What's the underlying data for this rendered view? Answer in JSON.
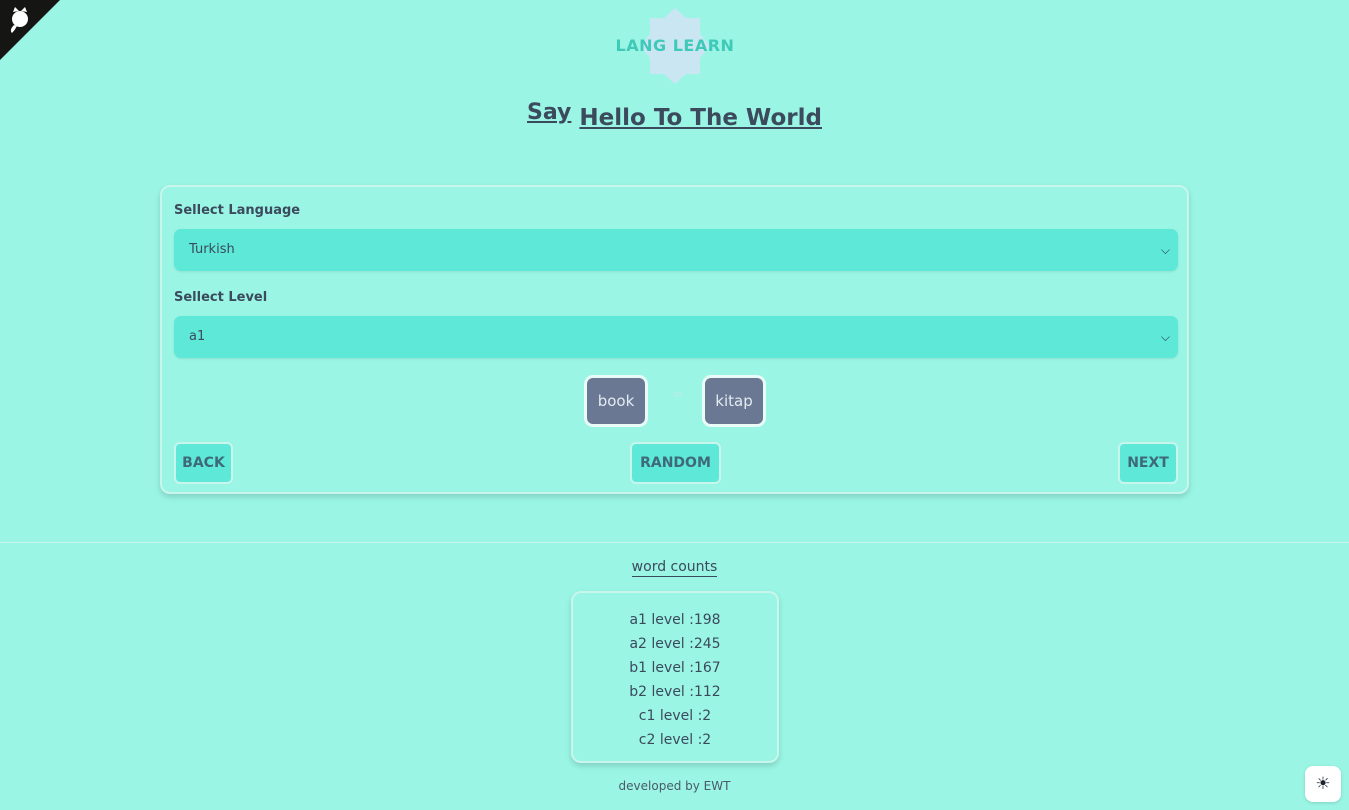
{
  "logo": {
    "text": "LANG LEARN"
  },
  "headline": {
    "say": "Say",
    "hello": "Hello To The World"
  },
  "form": {
    "language_label": "Sellect Language",
    "language_value": "Turkish",
    "level_label": "Sellect Level",
    "level_value": "a1"
  },
  "word": {
    "source": "book",
    "separator": "=",
    "target": "kitap"
  },
  "buttons": {
    "back": "BACK",
    "random": "RANDOM",
    "next": "NEXT"
  },
  "counts": {
    "title": "word counts",
    "rows": [
      "a1 level :198",
      "a2 level :245",
      "b1 level :167",
      "b2 level :112",
      "c1 level :2",
      "c2 level :2"
    ]
  },
  "footer": {
    "text": "developed by EWT"
  },
  "icons": {
    "corner": "github-octocat-icon",
    "theme": "sun-icon",
    "chevron": "chevron-down-icon"
  },
  "colors": {
    "background": "#9af5e4",
    "accent": "#5ee8d8",
    "word_box": "#6b7893",
    "text": "#3b4a5c"
  }
}
